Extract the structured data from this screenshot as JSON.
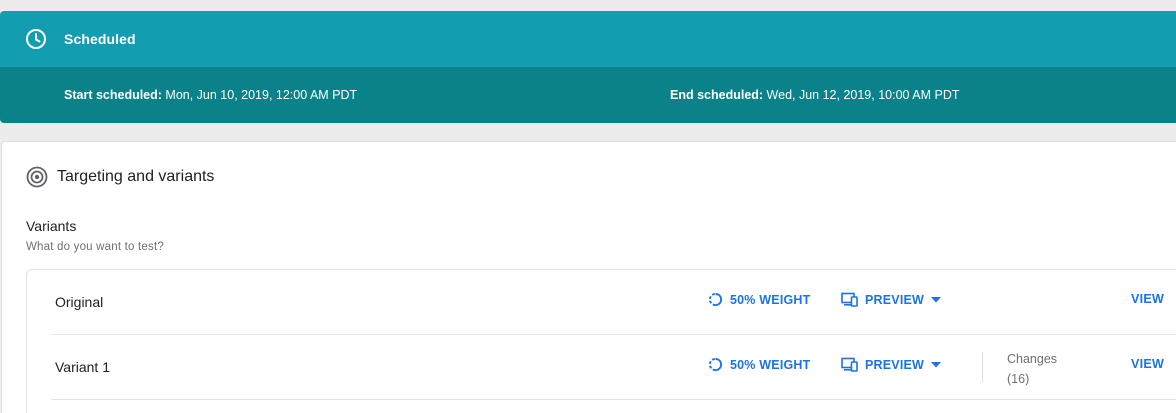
{
  "status": {
    "title": "Scheduled",
    "start_label": "Start scheduled:",
    "start_value": " Mon, Jun 10, 2019, 12:00 AM PDT",
    "end_label": "End scheduled:",
    "end_value": " Wed, Jun 12, 2019, 10:00 AM PDT"
  },
  "section": {
    "title": "Targeting and variants",
    "variants_label": "Variants",
    "variants_hint": "What do you want to test?"
  },
  "variants": [
    {
      "name": "Original",
      "weight": "50% WEIGHT",
      "preview": "PREVIEW",
      "view": "VIEW"
    },
    {
      "name": "Variant 1",
      "weight": "50% WEIGHT",
      "preview": "PREVIEW",
      "changes_label": "Changes",
      "changes_count": "(16)",
      "view": "VIEW"
    }
  ],
  "colors": {
    "status_top": "#129eb0",
    "status_bottom": "#0b8189",
    "link": "#1a73e8"
  },
  "icons": [
    "clock-icon",
    "target-icon",
    "weight-icon",
    "devices-icon",
    "caret-down-icon"
  ]
}
